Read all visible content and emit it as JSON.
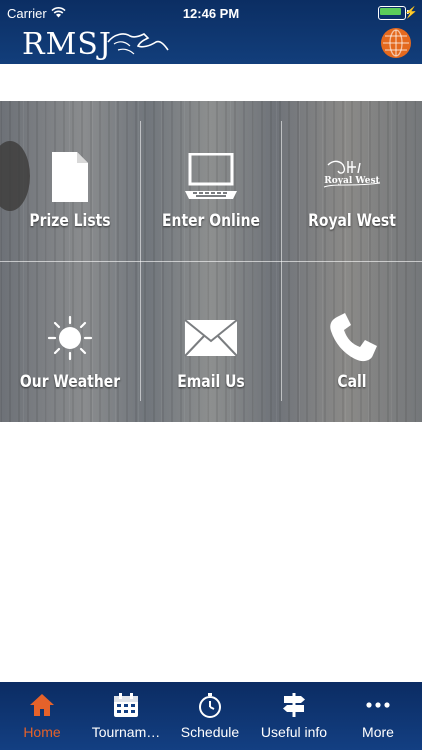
{
  "status_bar": {
    "carrier": "Carrier",
    "time": "12:46 PM"
  },
  "header": {
    "logo_text": "RMSJ",
    "accent_color": "#e4691e"
  },
  "tiles": [
    {
      "label": "Prize Lists",
      "icon": "document-icon"
    },
    {
      "label": "Enter Online",
      "icon": "laptop-icon"
    },
    {
      "label": "Royal West",
      "icon": "royal-west-logo"
    },
    {
      "label": "Our Weather",
      "icon": "sun-icon"
    },
    {
      "label": "Email Us",
      "icon": "envelope-icon"
    },
    {
      "label": "Call",
      "icon": "phone-icon"
    }
  ],
  "royal_west_logo_text": "Royal West",
  "tabs": [
    {
      "label": "Home",
      "icon": "home-icon",
      "active": true
    },
    {
      "label": "Tournam…",
      "icon": "calendar-icon",
      "active": false
    },
    {
      "label": "Schedule",
      "icon": "stopwatch-icon",
      "active": false
    },
    {
      "label": "Useful info",
      "icon": "signpost-icon",
      "active": false
    },
    {
      "label": "More",
      "icon": "more-icon",
      "active": false
    }
  ],
  "colors": {
    "bar_dark": "#0b2e63",
    "active_tab": "#e5622a",
    "battery": "#5ccd5a"
  }
}
